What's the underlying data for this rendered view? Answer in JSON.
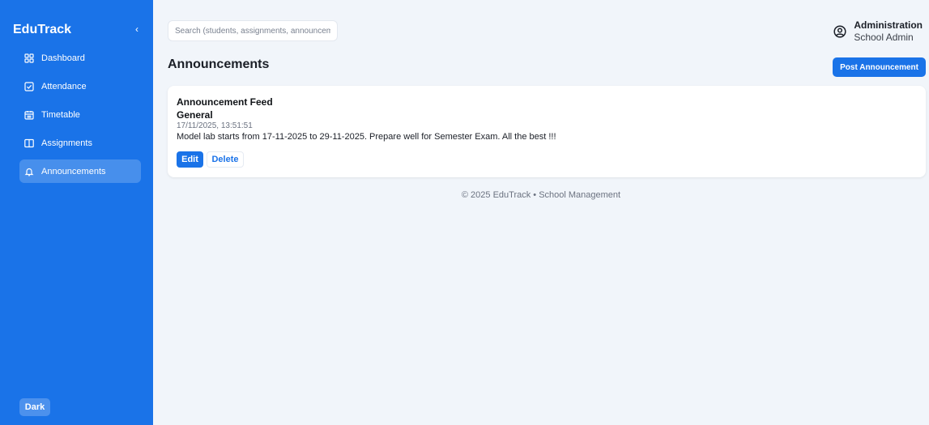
{
  "app": {
    "brand": "EduTrack",
    "collapse_glyph": "‹"
  },
  "sidebar": {
    "items": [
      {
        "label": "Dashboard",
        "icon": "grid-icon",
        "active": false
      },
      {
        "label": "Attendance",
        "icon": "checkbox-icon",
        "active": false
      },
      {
        "label": "Timetable",
        "icon": "calendar-icon",
        "active": false
      },
      {
        "label": "Assignments",
        "icon": "book-icon",
        "active": false
      },
      {
        "label": "Announcements",
        "icon": "bell-icon",
        "active": true
      }
    ],
    "theme_toggle": "Dark"
  },
  "header": {
    "search_placeholder": "Search (students, assignments, announcements)",
    "user_name": "Administration",
    "user_role": "School Admin"
  },
  "page": {
    "title": "Announcements",
    "post_button": "Post Announcement"
  },
  "feed": {
    "title": "Announcement Feed",
    "announcements": [
      {
        "category": "General",
        "timestamp": "17/11/2025, 13:51:51",
        "body": "Model lab starts from 17-11-2025 to 29-11-2025. Prepare well for Semester Exam. All the best !!!",
        "edit_label": "Edit",
        "delete_label": "Delete"
      }
    ]
  },
  "footer": {
    "text": "© 2025 EduTrack • School Management"
  },
  "colors": {
    "accent": "#1a73e8",
    "background": "#f1f5fa",
    "card": "#ffffff"
  }
}
